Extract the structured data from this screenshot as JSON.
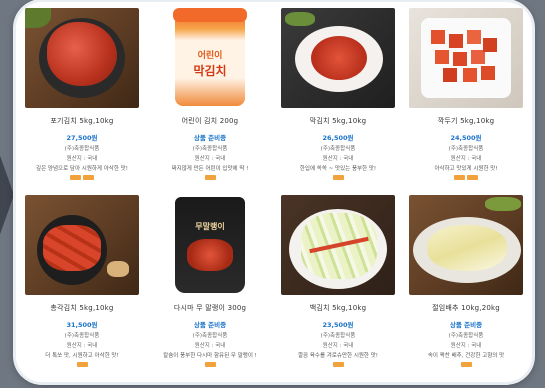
{
  "products": [
    {
      "name": "포기김치 5kg,10kg",
      "price": "27,500원",
      "maker": "(주)축종합식품",
      "origin": "원산지 : 국내",
      "desc": "깊은 양념으로 담아 시원하게 아삭한 맛!",
      "thumb": "kimchi-pot"
    },
    {
      "name": "어린이 김치 200g",
      "price": "상품 준비중",
      "maker": "(주)축종합식품",
      "origin": "원산지 : 국내",
      "desc": "짜지않게 만든 어린이 입맛에 딱 !",
      "thumb": "kids-kimchi-jar",
      "jar_text_1": "어린이",
      "jar_text_2": "막김치"
    },
    {
      "name": "막김치 5kg,10kg",
      "price": "26,500원",
      "maker": "(주)축종합식품",
      "origin": "원산지 : 국내",
      "desc": "한입에 쏙쏙 ~ 맛있는 풍부한 맛!",
      "thumb": "mak-kimchi"
    },
    {
      "name": "깍두기 5kg,10kg",
      "price": "24,500원",
      "maker": "(주)축종합식품",
      "origin": "원산지 : 국내",
      "desc": "아삭하고 맛있게 시원한 맛!",
      "thumb": "kkakdugi"
    },
    {
      "name": "총각김치 5kg,10kg",
      "price": "31,500원",
      "maker": "(주)축종합식품",
      "origin": "원산지 : 국내",
      "desc": "더 톡쏘 맛, 시원하고 아삭한 맛!",
      "thumb": "chonggak-kimchi"
    },
    {
      "name": "다시마 무 말랭이 300g",
      "price": "상품 준비중",
      "maker": "(주)축종합식품",
      "origin": "원산지 : 국내",
      "desc": "칼슘이 풍부한 다시마 함유된 무 말랭이 !",
      "thumb": "radish-pouch",
      "pouch_text": "무말랭이"
    },
    {
      "name": "백김치 5kg,10kg",
      "price": "23,500원",
      "maker": "(주)축종합식품",
      "origin": "원산지 : 국내",
      "desc": "깔끔 육수를 겨로슈만한 시원한 맛!",
      "thumb": "baek-kimchi"
    },
    {
      "name": "절임배추 10kg,20kg",
      "price": "상품 준비중",
      "maker": "(주)축종합식품",
      "origin": "원산지 : 국내",
      "desc": "속이 꽉찬 배추, 건강한 고향의 맛",
      "thumb": "salted-cabbage"
    }
  ],
  "colors": {
    "price": "#1a74c8",
    "badge": "#f2a23a",
    "panel": "#ffffff",
    "background": "#6f7782"
  }
}
